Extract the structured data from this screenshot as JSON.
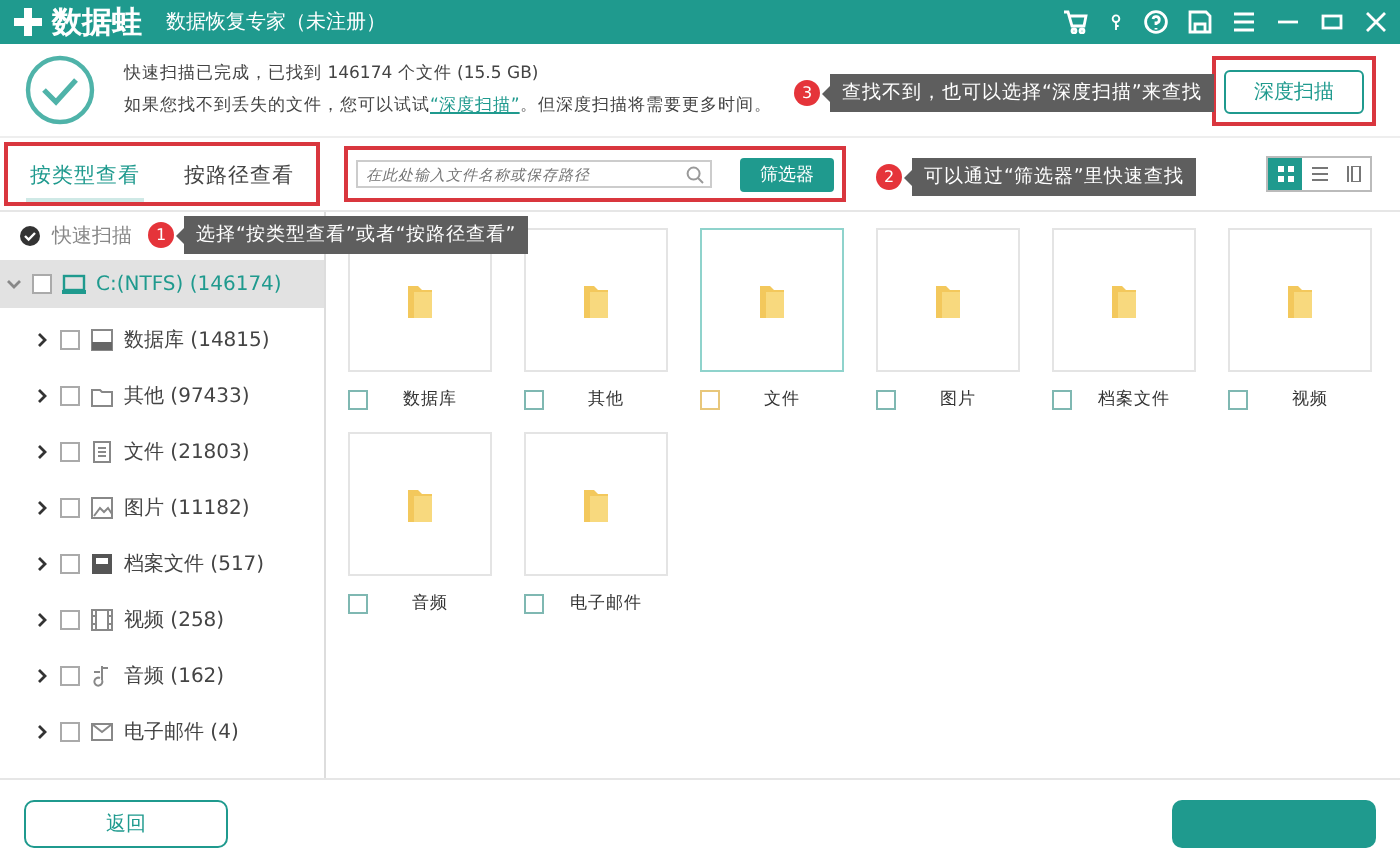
{
  "window": {
    "app_name": "数据蛙",
    "subtitle": "数据恢复专家（未注册）"
  },
  "header": {
    "status": "快速扫描已完成，已找到 146174 个文件 (15.5 GB)",
    "hint_before": "如果您找不到丢失的文件，您可以试试",
    "hint_link": "“深度扫描”",
    "hint_after": "。但深度扫描将需要更多时间。",
    "deep_scan_button": "深度扫描"
  },
  "tabs": [
    {
      "label": "按类型查看",
      "selected": true
    },
    {
      "label": "按路径查看",
      "selected": false
    }
  ],
  "search": {
    "placeholder": "在此处输入文件名称或保存路径"
  },
  "filter_button": "筛选器",
  "view_modes": [
    {
      "kind": "grid",
      "selected": true
    },
    {
      "kind": "list",
      "selected": false
    },
    {
      "kind": "columns",
      "selected": false
    }
  ],
  "quick_scan": "快速扫描",
  "tree": [
    {
      "label": "C:(NTFS) (146174)",
      "kind": "drive",
      "expanded": true,
      "checked": false,
      "selected": true,
      "children": [
        {
          "label": "数据库 (14815)",
          "kind": "database",
          "expanded": false,
          "checked": false,
          "selected": false
        },
        {
          "label": "其他 (97433)",
          "kind": "folder",
          "expanded": false,
          "checked": false,
          "selected": false
        },
        {
          "label": "文件 (21803)",
          "kind": "document",
          "expanded": false,
          "checked": false,
          "selected": false
        },
        {
          "label": "图片 (11182)",
          "kind": "image",
          "expanded": false,
          "checked": false,
          "selected": false
        },
        {
          "label": "档案文件 (517)",
          "kind": "archive",
          "expanded": false,
          "checked": false,
          "selected": false
        },
        {
          "label": "视频 (258)",
          "kind": "video",
          "expanded": false,
          "checked": false,
          "selected": false
        },
        {
          "label": "音频 (162)",
          "kind": "audio",
          "expanded": false,
          "checked": false,
          "selected": false
        },
        {
          "label": "电子邮件 (4)",
          "kind": "mail",
          "expanded": false,
          "checked": false,
          "selected": false
        }
      ]
    }
  ],
  "tiles": [
    {
      "label": "数据库",
      "checked": false,
      "selected": false
    },
    {
      "label": "其他",
      "checked": false,
      "selected": false
    },
    {
      "label": "文件",
      "checked": false,
      "selected": true
    },
    {
      "label": "图片",
      "checked": false,
      "selected": false
    },
    {
      "label": "档案文件",
      "checked": false,
      "selected": false
    },
    {
      "label": "视频",
      "checked": false,
      "selected": false
    },
    {
      "label": "音频",
      "checked": false,
      "selected": false
    },
    {
      "label": "电子邮件",
      "checked": false,
      "selected": false
    }
  ],
  "callouts": [
    {
      "number": "3",
      "text": "查找不到，也可以选择“深度扫描”来查找"
    },
    {
      "number": "2",
      "text": "可以通过“筛选器”里快速查找"
    },
    {
      "number": "1",
      "text": "选择“按类型查看”或者“按路径查看”"
    }
  ],
  "back_button": "返回"
}
